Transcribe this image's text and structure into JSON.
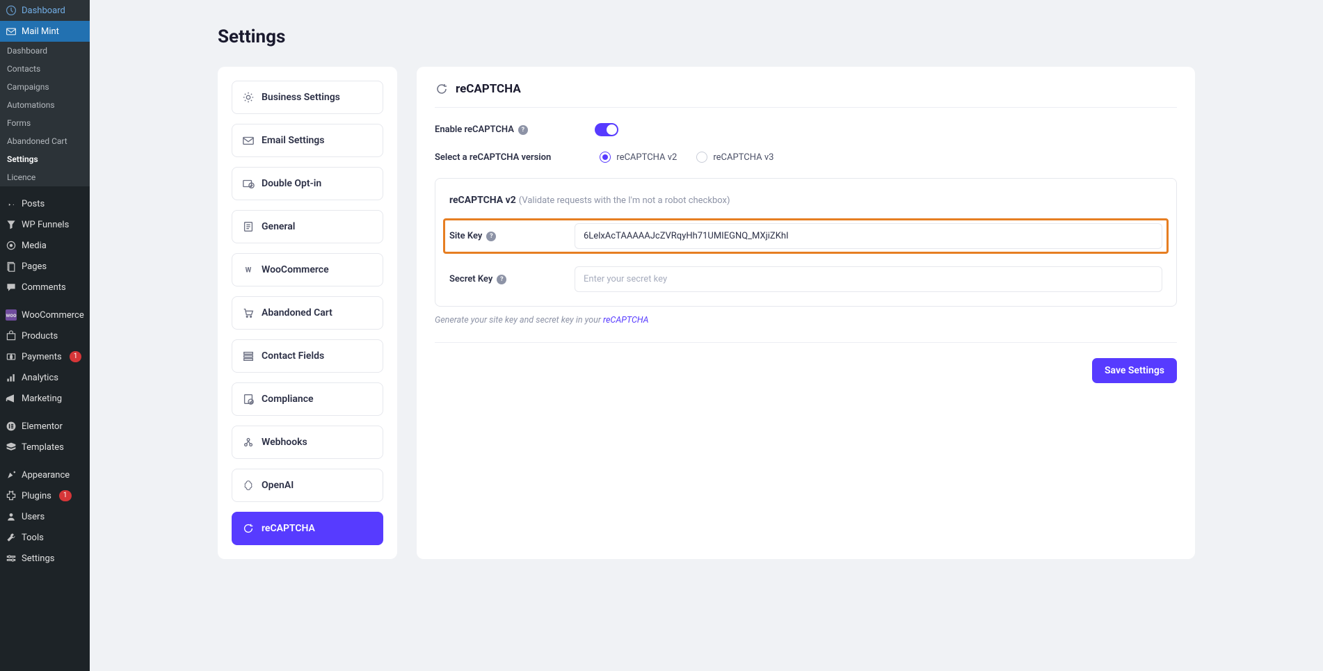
{
  "sidebar": {
    "dashboard": "Dashboard",
    "mailmint": "Mail Mint",
    "mm_sub": {
      "dashboard": "Dashboard",
      "contacts": "Contacts",
      "campaigns": "Campaigns",
      "automations": "Automations",
      "forms": "Forms",
      "abandoned_cart": "Abandoned Cart",
      "settings": "Settings",
      "licence": "Licence"
    },
    "posts": "Posts",
    "wpfunnels": "WP Funnels",
    "media": "Media",
    "pages": "Pages",
    "comments": "Comments",
    "woocommerce": "WooCommerce",
    "products": "Products",
    "payments": "Payments",
    "payments_badge": "1",
    "analytics": "Analytics",
    "marketing": "Marketing",
    "elementor": "Elementor",
    "templates": "Templates",
    "appearance": "Appearance",
    "plugins": "Plugins",
    "plugins_badge": "1",
    "users": "Users",
    "tools": "Tools",
    "settings_wp": "Settings"
  },
  "page": {
    "title": "Settings"
  },
  "nav": {
    "business": "Business Settings",
    "email": "Email Settings",
    "double_optin": "Double Opt-in",
    "general": "General",
    "woocommerce": "WooCommerce",
    "abandoned_cart": "Abandoned Cart",
    "contact_fields": "Contact Fields",
    "compliance": "Compliance",
    "webhooks": "Webhooks",
    "openai": "OpenAI",
    "recaptcha": "reCAPTCHA"
  },
  "panel": {
    "title": "reCAPTCHA",
    "enable_label": "Enable reCAPTCHA",
    "version_label": "Select a reCAPTCHA version",
    "v2_label": "reCAPTCHA v2",
    "v3_label": "reCAPTCHA v3",
    "config_title": "reCAPTCHA v2",
    "config_sub": "(Validate requests with the I'm not a robot checkbox)",
    "site_key_label": "Site Key",
    "site_key_value": "6LelxAcTAAAAAJcZVRqyHh71UMIEGNQ_MXjiZKhI",
    "secret_key_label": "Secret Key",
    "secret_key_placeholder": "Enter your secret key",
    "hint_prefix": "Generate your site key and secret key in your ",
    "hint_link": "reCAPTCHA",
    "save": "Save Settings"
  }
}
